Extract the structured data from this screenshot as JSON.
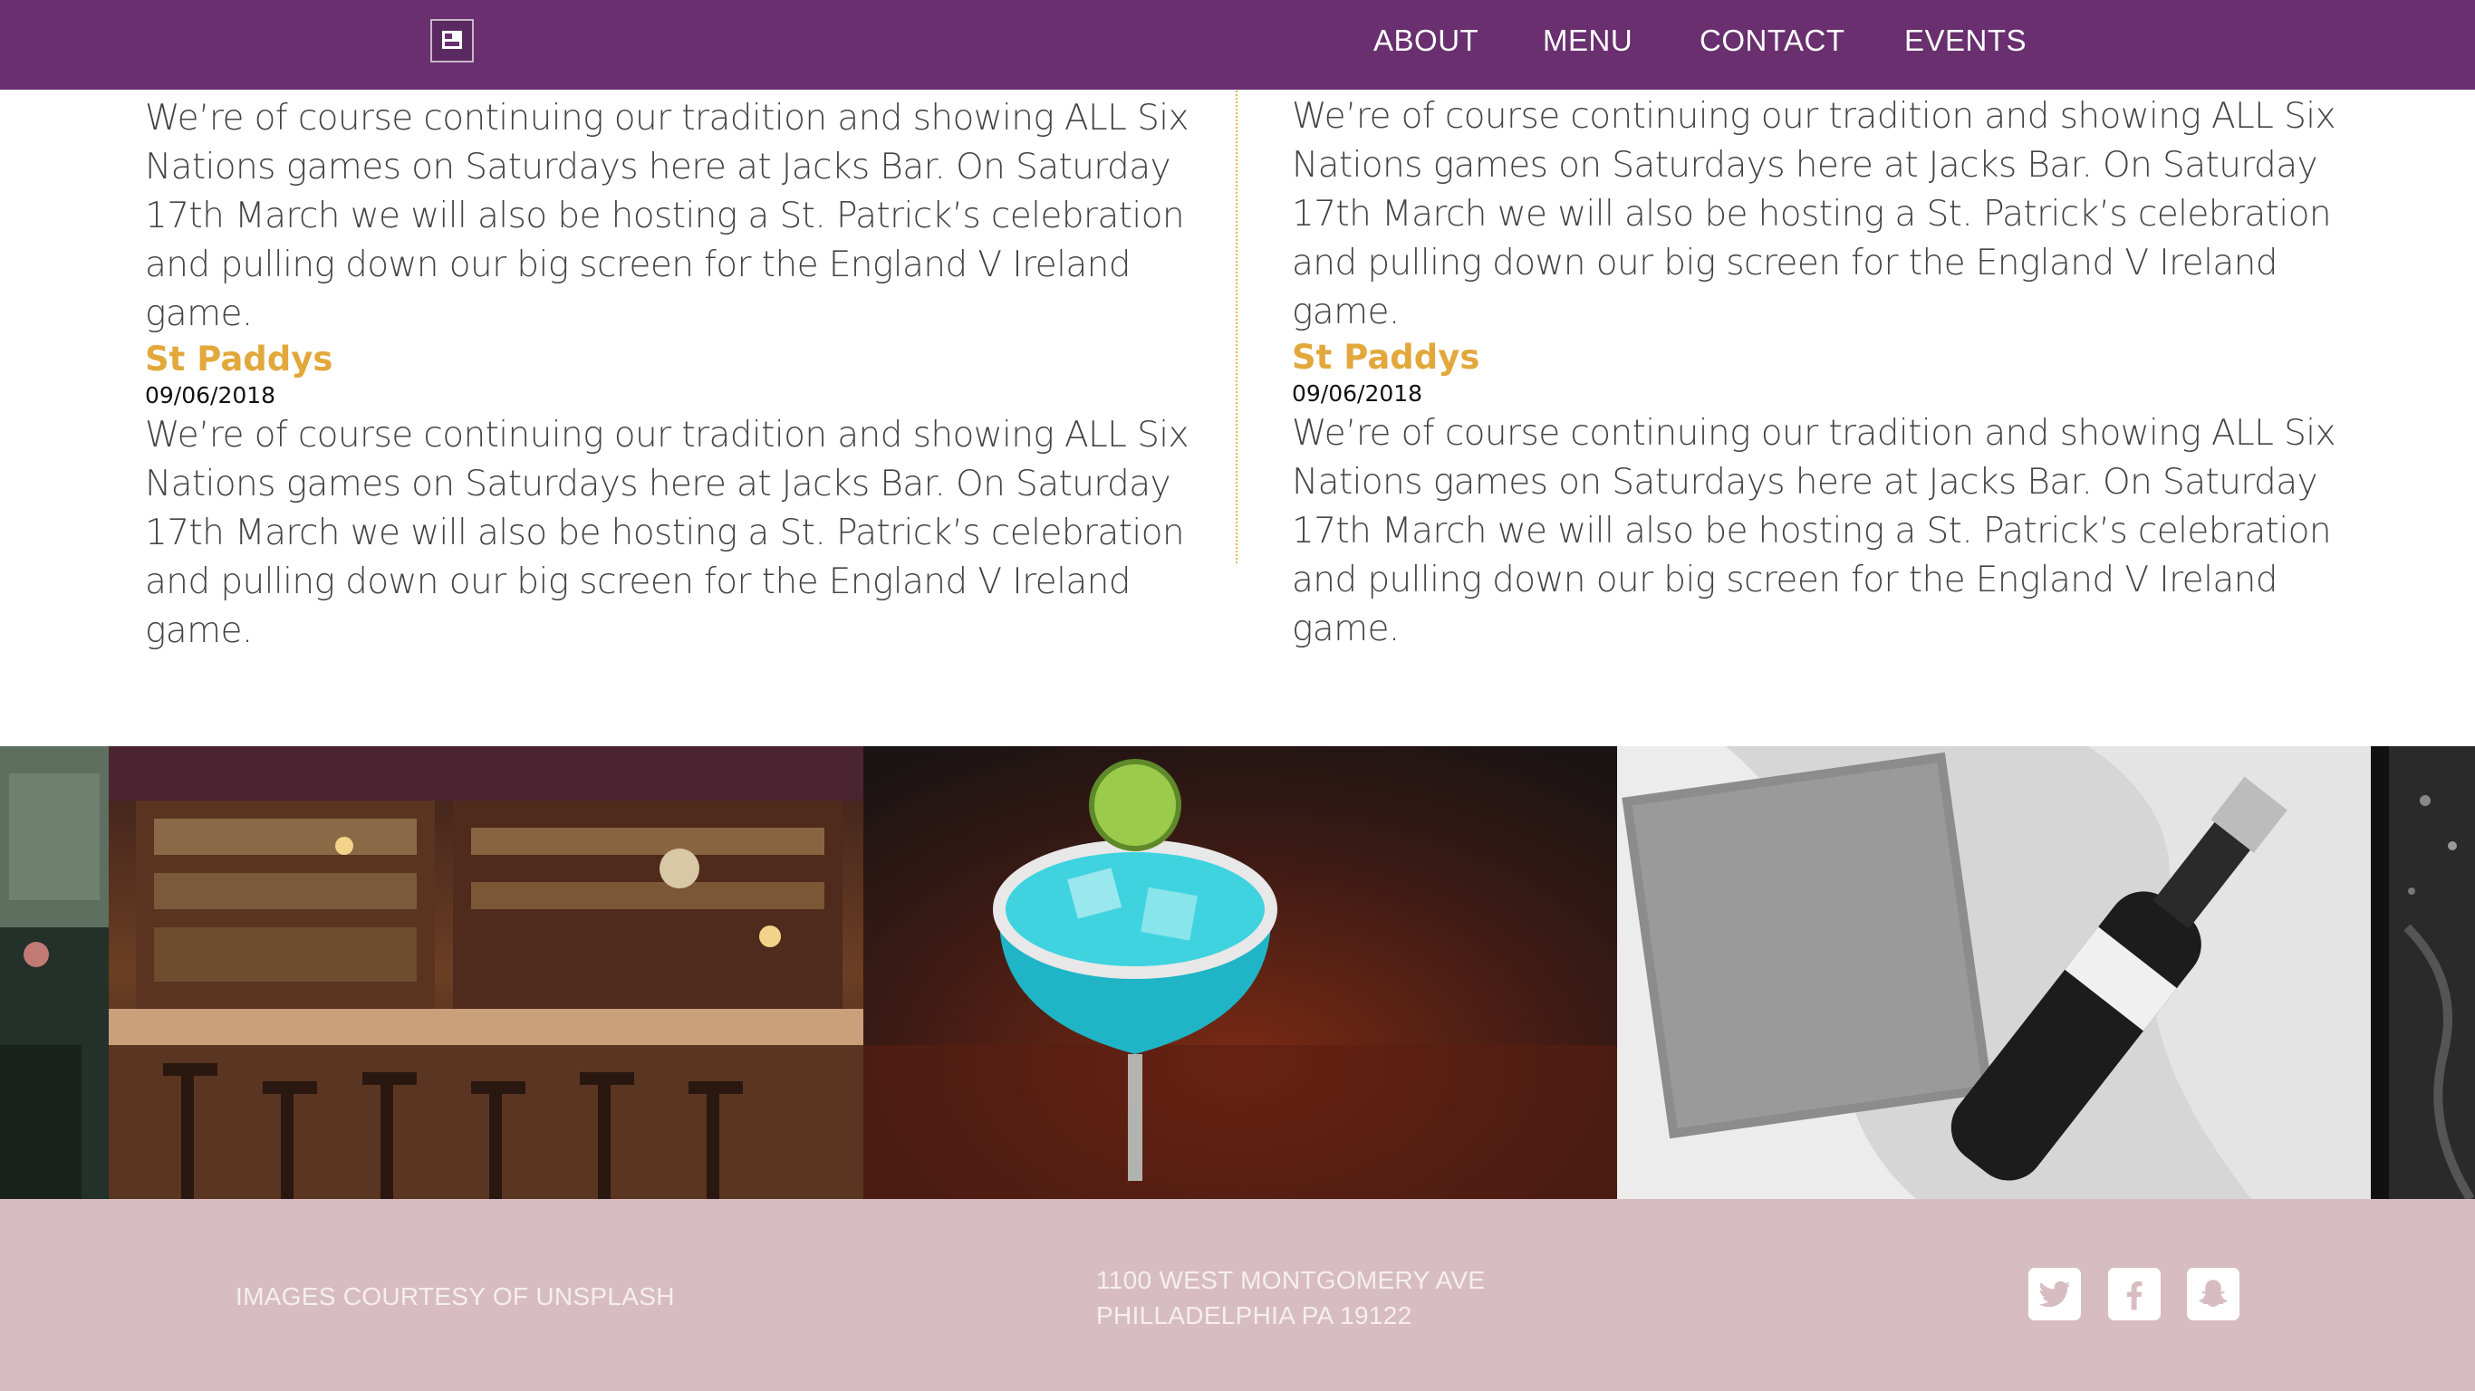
{
  "nav": {
    "logo_alt": "Jacks Bar logo",
    "links": [
      "ABOUT",
      "MENU",
      "CONTACT",
      "EVENTS"
    ]
  },
  "articles": {
    "left": {
      "intro": "We’re of course continuing our tradition and showing ALL Six Nations games on Saturdays here at Jacks Bar. On Saturday 17th March we will also be hosting a St. Patrick’s celebration and pulling down our big screen for the England V Ireland game.",
      "title": "St Paddys",
      "date": "09/06/2018",
      "body": "We’re of course continuing our tradition and showing ALL Six Nations games on Saturdays here at Jacks Bar. On Saturday 17th March we will also be hosting a St. Patrick’s celebration and pulling down our big screen for the England V Ireland game."
    },
    "right": {
      "intro": "We’re of course continuing our tradition and showing ALL Six Nations games on Saturdays here at Jacks Bar. On Saturday 17th March we will also be hosting a St. Patrick’s celebration and pulling down our big screen for the England V Ireland game.",
      "title": "St Paddys",
      "date": "09/06/2018",
      "body": "We’re of course continuing our tradition and showing ALL Six Nations games on Saturdays here at Jacks Bar. On Saturday 17th March we will also be hosting a St. Patrick’s celebration and pulling down our big screen for the England V Ireland game."
    }
  },
  "gallery": {
    "images": [
      "bar-interior-photo",
      "blue-margarita-photo",
      "champagne-bottle-photo"
    ]
  },
  "footer": {
    "credit": "IMAGES COURTESY OF UNSPLASH",
    "address_line1": "1100 WEST MONTGOMERY AVE",
    "address_line2": "PHILLADELPHIA PA 19122",
    "social": [
      "twitter-icon",
      "facebook-icon",
      "snapchat-icon"
    ]
  },
  "colors": {
    "nav_bg": "#692f6f",
    "title_gold": "#e2a83b",
    "footer_bg": "#d7bdc1"
  }
}
